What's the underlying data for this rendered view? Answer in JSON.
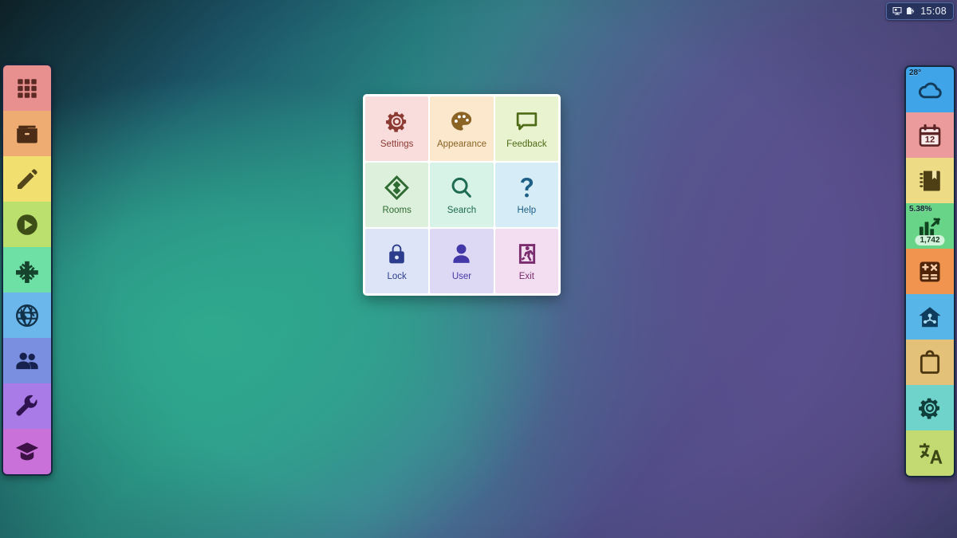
{
  "statusbar": {
    "display_icon": "display-icon",
    "battery_icon": "battery-charging-icon",
    "time": "15:08"
  },
  "menu": {
    "tiles": [
      {
        "label": "Settings",
        "icon": "gear-icon",
        "bg": "#f9dcdc",
        "fg": "#8c3b32"
      },
      {
        "label": "Appearance",
        "icon": "palette-icon",
        "bg": "#fce8cd",
        "fg": "#8a6325"
      },
      {
        "label": "Feedback",
        "icon": "speech-bubble-icon",
        "bg": "#eaf3cf",
        "fg": "#4d6b17"
      },
      {
        "label": "Rooms",
        "icon": "rooms-diamond-icon",
        "bg": "#ddf0dc",
        "fg": "#2f6b32"
      },
      {
        "label": "Search",
        "icon": "magnifier-icon",
        "bg": "#d7f2e6",
        "fg": "#1d6b52"
      },
      {
        "label": "Help",
        "icon": "question-mark-icon",
        "bg": "#d6ecf7",
        "fg": "#1d5f86"
      },
      {
        "label": "Lock",
        "icon": "lock-icon",
        "bg": "#dde4f7",
        "fg": "#2b3d8c"
      },
      {
        "label": "User",
        "icon": "user-icon",
        "bg": "#ddd9f5",
        "fg": "#4338a8"
      },
      {
        "label": "Exit",
        "icon": "exit-door-icon",
        "bg": "#f3ddf1",
        "fg": "#7a2c6e"
      }
    ]
  },
  "dock_left": {
    "items": [
      {
        "name": "apps-grid",
        "icon": "grid-apps-icon",
        "bg": "#e89090",
        "fg": "#5c2a24"
      },
      {
        "name": "files",
        "icon": "folder-icon",
        "bg": "#efac72",
        "fg": "#4c2c16"
      },
      {
        "name": "editor",
        "icon": "pencil-icon",
        "bg": "#f1e070",
        "fg": "#53461a"
      },
      {
        "name": "media",
        "icon": "play-circle-icon",
        "bg": "#bbe06e",
        "fg": "#3d4e16"
      },
      {
        "name": "games",
        "icon": "gamepad-dpad-icon",
        "bg": "#6fe0a5",
        "fg": "#15432c"
      },
      {
        "name": "browser",
        "icon": "globe-icon",
        "bg": "#6bb6ea",
        "fg": "#123249"
      },
      {
        "name": "contacts",
        "icon": "people-icon",
        "bg": "#7b8fe0",
        "fg": "#16214d"
      },
      {
        "name": "tools",
        "icon": "wrench-icon",
        "bg": "#a97be6",
        "fg": "#2f1350"
      },
      {
        "name": "learning",
        "icon": "graduation-cap-icon",
        "bg": "#c971d9",
        "fg": "#3d1145"
      }
    ]
  },
  "dock_right": {
    "items": [
      {
        "name": "weather",
        "icon": "cloud-icon",
        "bg": "#3fa5e8",
        "fg": "#123b5c",
        "badge_top": "28°",
        "badge_pill": ""
      },
      {
        "name": "calendar",
        "icon": "calendar-12-icon",
        "bg": "#eb9b9b",
        "fg": "#5c2424",
        "badge_top": "",
        "badge_pill": "",
        "calendar_day": "12"
      },
      {
        "name": "notebook",
        "icon": "notebook-icon",
        "bg": "#eddc85",
        "fg": "#4f3f14",
        "badge_top": "",
        "badge_pill": ""
      },
      {
        "name": "stats",
        "icon": "bar-chart-up-icon",
        "bg": "#68d488",
        "fg": "#10441f",
        "badge_top": "5.38%",
        "badge_pill": "1,742"
      },
      {
        "name": "calculator",
        "icon": "calculator-icon",
        "bg": "#f0944f",
        "fg": "#4f2409",
        "badge_top": "",
        "badge_pill": ""
      },
      {
        "name": "smart-home",
        "icon": "smart-home-icon",
        "bg": "#57b5e8",
        "fg": "#0f3c5c",
        "badge_top": "",
        "badge_pill": ""
      },
      {
        "name": "clipboard",
        "icon": "clipboard-icon",
        "bg": "#e3c178",
        "fg": "#4c3610",
        "badge_top": "",
        "badge_pill": ""
      },
      {
        "name": "settings",
        "icon": "gear-icon",
        "bg": "#6fd2cb",
        "fg": "#103e3a",
        "badge_top": "",
        "badge_pill": ""
      },
      {
        "name": "translate",
        "icon": "translate-icon",
        "bg": "#c3d971",
        "fg": "#3d4716",
        "badge_top": "",
        "badge_pill": ""
      }
    ]
  }
}
